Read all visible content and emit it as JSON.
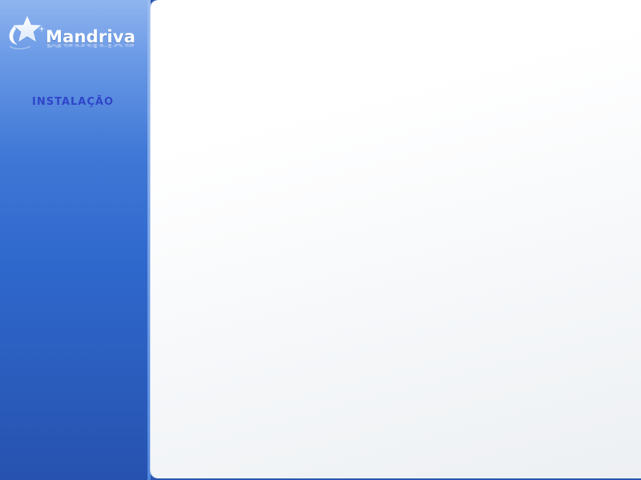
{
  "brand": {
    "name": "Mandriva",
    "logo_icon": "mandriva-star-icon"
  },
  "sidebar": {
    "steps": [
      {
        "label": "INSTALAÇÃO"
      }
    ]
  },
  "colors": {
    "sidebar_top": "#8fb4ef",
    "sidebar_bottom": "#2752b0",
    "step_label": "#2f45c8",
    "content_background": "#ffffff"
  }
}
